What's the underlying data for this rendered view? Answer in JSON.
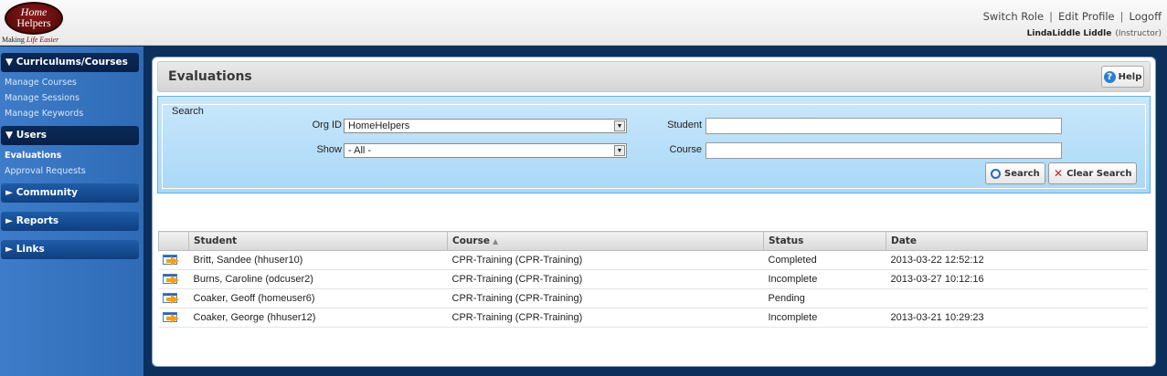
{
  "brand": {
    "logo_line1": "Home",
    "logo_line2": "Helpers",
    "tagline_prefix": "Making ",
    "tagline_emph": "Life Easier"
  },
  "toplinks": {
    "switch_role": "Switch Role",
    "edit_profile": "Edit Profile",
    "logoff": "Logoff",
    "separator": "|"
  },
  "user": {
    "name": "LindaLiddle Liddle",
    "role": "(Instructor)"
  },
  "sidebar": {
    "sections": [
      {
        "label": "▼ Curriculums/Courses",
        "items": [
          "Manage Courses",
          "Manage Sessions",
          "Manage Keywords"
        ]
      },
      {
        "label": "▼ Users",
        "items": [
          "Evaluations",
          "Approval Requests"
        ]
      },
      {
        "label": "► Community"
      },
      {
        "label": "► Reports"
      },
      {
        "label": "► Links"
      }
    ]
  },
  "page": {
    "title": "Evaluations",
    "help_label": "Help"
  },
  "search": {
    "legend": "Search",
    "org_label": "Org ID",
    "org_value": "HomeHelpers",
    "show_label": "Show",
    "show_value": "- All -",
    "student_label": "Student",
    "course_label": "Course",
    "search_button": "Search",
    "clear_button": "Clear Search"
  },
  "table": {
    "headers": [
      "Student",
      "Course",
      "Status",
      "Date"
    ],
    "rows": [
      {
        "student": "Britt, Sandee (hhuser10)",
        "course": "CPR-Training (CPR-Training)",
        "status": "Completed",
        "date": "2013-03-22 12:52:12"
      },
      {
        "student": "Burns, Caroline (odcuser2)",
        "course": "CPR-Training (CPR-Training)",
        "status": "Incomplete",
        "date": "2013-03-27 10:12:16"
      },
      {
        "student": "Coaker, Geoff (homeuser6)",
        "course": "CPR-Training (CPR-Training)",
        "status": "Pending",
        "date": ""
      },
      {
        "student": "Coaker, George (hhuser12)",
        "course": "CPR-Training (CPR-Training)",
        "status": "Incomplete",
        "date": "2013-03-21 10:29:23"
      }
    ]
  },
  "colors": {
    "sidebar_bg": "#3e7cc9",
    "section_bg": "#0f3f80",
    "search_bg": "#a9d8f7",
    "page_bg": "#0d2f5c"
  }
}
